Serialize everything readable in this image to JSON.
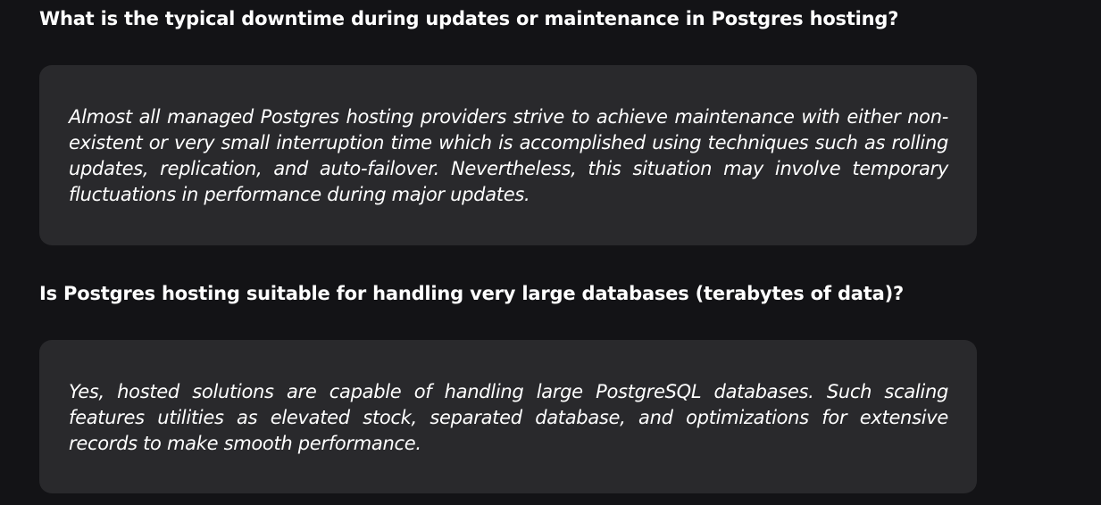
{
  "faq": {
    "items": [
      {
        "question": "What is the typical downtime during updates or maintenance in Postgres hosting?",
        "answer": "Almost all managed Postgres hosting providers strive to achieve maintenance with either non-existent or very small interruption time which is accomplished using techniques such as rolling updates, replication, and auto-failover. Nevertheless, this situation may involve temporary fluctuations in performance during major updates."
      },
      {
        "question": "Is Postgres hosting suitable for handling very large databases (terabytes of data)?",
        "answer": "Yes, hosted solutions are capable of handling large PostgreSQL databases. Such scaling features utilities as elevated stock, separated database, and optimizations for extensive records to make smooth performance."
      }
    ]
  },
  "colors": {
    "background": "#131316",
    "card": "#29292c",
    "text": "#ffffff"
  }
}
